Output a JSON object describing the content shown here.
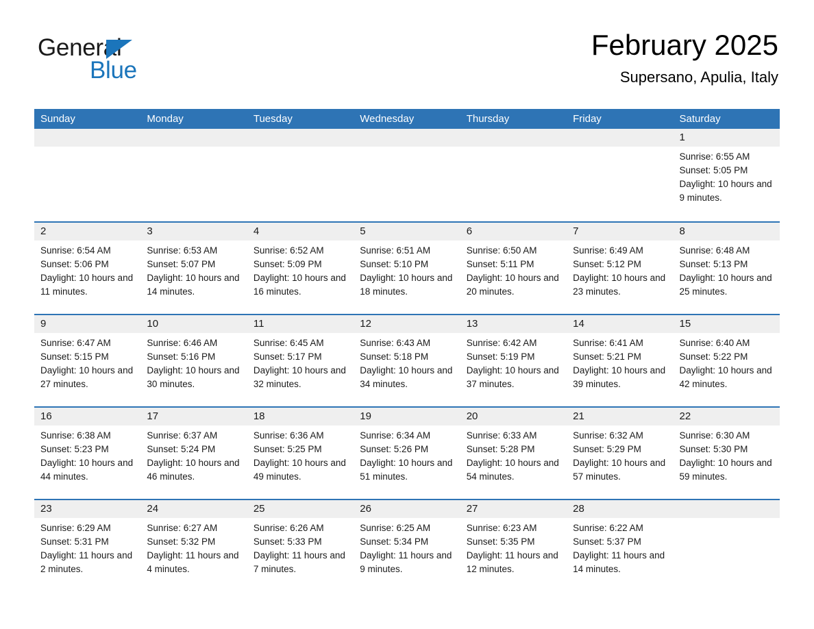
{
  "logo": {
    "word1": "General",
    "word2": "Blue",
    "triangle_color": "#1b75bb"
  },
  "header": {
    "title": "February 2025",
    "subtitle": "Supersano, Apulia, Italy"
  },
  "colors": {
    "header_blue": "#2e74b5",
    "day_band_gray": "#efefef",
    "text": "#1a1a1a"
  },
  "weekdays": [
    "Sunday",
    "Monday",
    "Tuesday",
    "Wednesday",
    "Thursday",
    "Friday",
    "Saturday"
  ],
  "weeks": [
    [
      {
        "day": "",
        "sunrise": "",
        "sunset": "",
        "daylight": "",
        "empty": true
      },
      {
        "day": "",
        "sunrise": "",
        "sunset": "",
        "daylight": "",
        "empty": true
      },
      {
        "day": "",
        "sunrise": "",
        "sunset": "",
        "daylight": "",
        "empty": true
      },
      {
        "day": "",
        "sunrise": "",
        "sunset": "",
        "daylight": "",
        "empty": true
      },
      {
        "day": "",
        "sunrise": "",
        "sunset": "",
        "daylight": "",
        "empty": true
      },
      {
        "day": "",
        "sunrise": "",
        "sunset": "",
        "daylight": "",
        "empty": true
      },
      {
        "day": "1",
        "sunrise": "Sunrise: 6:55 AM",
        "sunset": "Sunset: 5:05 PM",
        "daylight": "Daylight: 10 hours and 9 minutes.",
        "empty": false
      }
    ],
    [
      {
        "day": "2",
        "sunrise": "Sunrise: 6:54 AM",
        "sunset": "Sunset: 5:06 PM",
        "daylight": "Daylight: 10 hours and 11 minutes.",
        "empty": false
      },
      {
        "day": "3",
        "sunrise": "Sunrise: 6:53 AM",
        "sunset": "Sunset: 5:07 PM",
        "daylight": "Daylight: 10 hours and 14 minutes.",
        "empty": false
      },
      {
        "day": "4",
        "sunrise": "Sunrise: 6:52 AM",
        "sunset": "Sunset: 5:09 PM",
        "daylight": "Daylight: 10 hours and 16 minutes.",
        "empty": false
      },
      {
        "day": "5",
        "sunrise": "Sunrise: 6:51 AM",
        "sunset": "Sunset: 5:10 PM",
        "daylight": "Daylight: 10 hours and 18 minutes.",
        "empty": false
      },
      {
        "day": "6",
        "sunrise": "Sunrise: 6:50 AM",
        "sunset": "Sunset: 5:11 PM",
        "daylight": "Daylight: 10 hours and 20 minutes.",
        "empty": false
      },
      {
        "day": "7",
        "sunrise": "Sunrise: 6:49 AM",
        "sunset": "Sunset: 5:12 PM",
        "daylight": "Daylight: 10 hours and 23 minutes.",
        "empty": false
      },
      {
        "day": "8",
        "sunrise": "Sunrise: 6:48 AM",
        "sunset": "Sunset: 5:13 PM",
        "daylight": "Daylight: 10 hours and 25 minutes.",
        "empty": false
      }
    ],
    [
      {
        "day": "9",
        "sunrise": "Sunrise: 6:47 AM",
        "sunset": "Sunset: 5:15 PM",
        "daylight": "Daylight: 10 hours and 27 minutes.",
        "empty": false
      },
      {
        "day": "10",
        "sunrise": "Sunrise: 6:46 AM",
        "sunset": "Sunset: 5:16 PM",
        "daylight": "Daylight: 10 hours and 30 minutes.",
        "empty": false
      },
      {
        "day": "11",
        "sunrise": "Sunrise: 6:45 AM",
        "sunset": "Sunset: 5:17 PM",
        "daylight": "Daylight: 10 hours and 32 minutes.",
        "empty": false
      },
      {
        "day": "12",
        "sunrise": "Sunrise: 6:43 AM",
        "sunset": "Sunset: 5:18 PM",
        "daylight": "Daylight: 10 hours and 34 minutes.",
        "empty": false
      },
      {
        "day": "13",
        "sunrise": "Sunrise: 6:42 AM",
        "sunset": "Sunset: 5:19 PM",
        "daylight": "Daylight: 10 hours and 37 minutes.",
        "empty": false
      },
      {
        "day": "14",
        "sunrise": "Sunrise: 6:41 AM",
        "sunset": "Sunset: 5:21 PM",
        "daylight": "Daylight: 10 hours and 39 minutes.",
        "empty": false
      },
      {
        "day": "15",
        "sunrise": "Sunrise: 6:40 AM",
        "sunset": "Sunset: 5:22 PM",
        "daylight": "Daylight: 10 hours and 42 minutes.",
        "empty": false
      }
    ],
    [
      {
        "day": "16",
        "sunrise": "Sunrise: 6:38 AM",
        "sunset": "Sunset: 5:23 PM",
        "daylight": "Daylight: 10 hours and 44 minutes.",
        "empty": false
      },
      {
        "day": "17",
        "sunrise": "Sunrise: 6:37 AM",
        "sunset": "Sunset: 5:24 PM",
        "daylight": "Daylight: 10 hours and 46 minutes.",
        "empty": false
      },
      {
        "day": "18",
        "sunrise": "Sunrise: 6:36 AM",
        "sunset": "Sunset: 5:25 PM",
        "daylight": "Daylight: 10 hours and 49 minutes.",
        "empty": false
      },
      {
        "day": "19",
        "sunrise": "Sunrise: 6:34 AM",
        "sunset": "Sunset: 5:26 PM",
        "daylight": "Daylight: 10 hours and 51 minutes.",
        "empty": false
      },
      {
        "day": "20",
        "sunrise": "Sunrise: 6:33 AM",
        "sunset": "Sunset: 5:28 PM",
        "daylight": "Daylight: 10 hours and 54 minutes.",
        "empty": false
      },
      {
        "day": "21",
        "sunrise": "Sunrise: 6:32 AM",
        "sunset": "Sunset: 5:29 PM",
        "daylight": "Daylight: 10 hours and 57 minutes.",
        "empty": false
      },
      {
        "day": "22",
        "sunrise": "Sunrise: 6:30 AM",
        "sunset": "Sunset: 5:30 PM",
        "daylight": "Daylight: 10 hours and 59 minutes.",
        "empty": false
      }
    ],
    [
      {
        "day": "23",
        "sunrise": "Sunrise: 6:29 AM",
        "sunset": "Sunset: 5:31 PM",
        "daylight": "Daylight: 11 hours and 2 minutes.",
        "empty": false
      },
      {
        "day": "24",
        "sunrise": "Sunrise: 6:27 AM",
        "sunset": "Sunset: 5:32 PM",
        "daylight": "Daylight: 11 hours and 4 minutes.",
        "empty": false
      },
      {
        "day": "25",
        "sunrise": "Sunrise: 6:26 AM",
        "sunset": "Sunset: 5:33 PM",
        "daylight": "Daylight: 11 hours and 7 minutes.",
        "empty": false
      },
      {
        "day": "26",
        "sunrise": "Sunrise: 6:25 AM",
        "sunset": "Sunset: 5:34 PM",
        "daylight": "Daylight: 11 hours and 9 minutes.",
        "empty": false
      },
      {
        "day": "27",
        "sunrise": "Sunrise: 6:23 AM",
        "sunset": "Sunset: 5:35 PM",
        "daylight": "Daylight: 11 hours and 12 minutes.",
        "empty": false
      },
      {
        "day": "28",
        "sunrise": "Sunrise: 6:22 AM",
        "sunset": "Sunset: 5:37 PM",
        "daylight": "Daylight: 11 hours and 14 minutes.",
        "empty": false
      },
      {
        "day": "",
        "sunrise": "",
        "sunset": "",
        "daylight": "",
        "empty": true
      }
    ]
  ]
}
